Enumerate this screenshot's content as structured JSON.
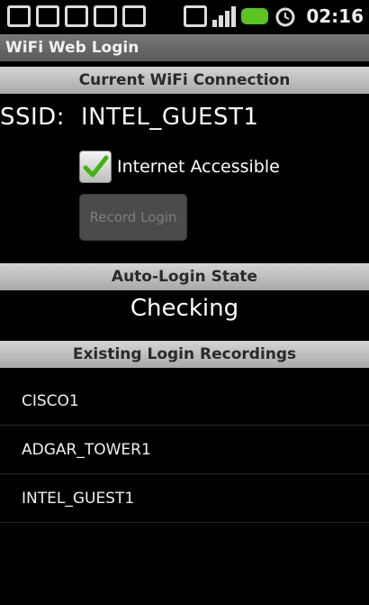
{
  "status_bar": {
    "time": "02:16",
    "icons": [
      "notification-icon",
      "download-icon",
      "gmail-icon",
      "usb-icon",
      "camera-icon",
      "sim-icon",
      "signal-icon",
      "battery-icon",
      "alarm-icon"
    ]
  },
  "app": {
    "title": "WiFi Web Login"
  },
  "current_connection": {
    "header": "Current WiFi Connection",
    "ssid_label": "SSID:",
    "ssid_value": "INTEL_GUEST1",
    "internet_label": "Internet Accessible",
    "internet_checked": true,
    "record_button": "Record Login"
  },
  "auto_login": {
    "header": "Auto-Login State",
    "value": "Checking"
  },
  "recordings": {
    "header": "Existing Login Recordings",
    "items": [
      "CISCO1",
      "ADGAR_TOWER1",
      "INTEL_GUEST1"
    ]
  },
  "colors": {
    "check": "#3fb312",
    "battery": "#5ac420"
  }
}
